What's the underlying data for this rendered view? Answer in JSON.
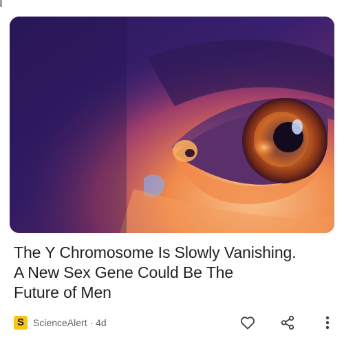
{
  "article": {
    "headline_lines": [
      "The Y Chromosome Is Slowly Vanishing.",
      "A New Sex Gene Could Be The",
      "Future of Men"
    ],
    "image_alt": "Close-up of an eye in purple and orange light"
  },
  "source": {
    "logo_letter": "S",
    "name": "ScienceAlert",
    "age": "4d",
    "separator": " · "
  },
  "actions": {
    "like_icon": "heart-icon",
    "share_icon": "share-icon",
    "more_icon": "more-vert-icon"
  },
  "colors": {
    "headline": "#202124",
    "meta": "#5f6368",
    "logo_bg": "#f5c518"
  }
}
